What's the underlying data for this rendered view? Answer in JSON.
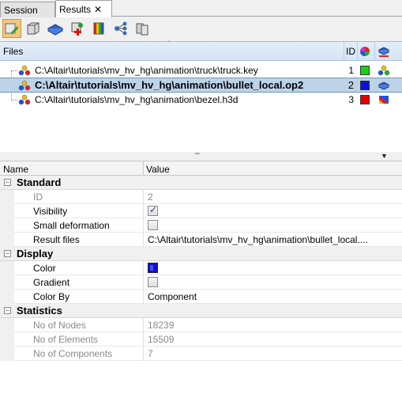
{
  "tabs": [
    {
      "label": "Session"
    },
    {
      "label": "Results",
      "close": "✕"
    }
  ],
  "toolbar": {
    "buttons": [
      "load-results-icon",
      "box-icon",
      "model-layer-icon",
      "add-component-icon",
      "contour-icon",
      "tree-network-icon",
      "cylinder-stack-icon"
    ]
  },
  "files": {
    "header": {
      "name": "Files",
      "id": "ID",
      "sort_indicator": "ˆ"
    },
    "rows": [
      {
        "path": "C:\\Altair\\tutorials\\mv_hv_hg\\animation\\truck\\truck.key",
        "id": "1",
        "color": "#16d216",
        "icon": "model-icon"
      },
      {
        "path": "C:\\Altair\\tutorials\\mv_hv_hg\\animation\\bullet_local.op2",
        "id": "2",
        "color": "#1010d0",
        "icon": "model-icon"
      },
      {
        "path": "C:\\Altair\\tutorials\\mv_hv_hg\\animation\\bezel.h3d",
        "id": "3",
        "color": "#e00000",
        "icon": "model-icon"
      }
    ]
  },
  "splitter": {
    "grip": "'''",
    "menu": "▼"
  },
  "props": {
    "header": {
      "name": "Name",
      "value": "Value"
    },
    "groups": {
      "standard": {
        "title": "Standard",
        "id_label": "ID",
        "id_value": "2",
        "visibility_label": "Visibility",
        "visibility_checked": true,
        "smalldef_label": "Small deformation",
        "smalldef_checked": false,
        "resultfiles_label": "Result files",
        "resultfiles_value": "C:\\Altair\\tutorials\\mv_hv_hg\\animation\\bullet_local...."
      },
      "display": {
        "title": "Display",
        "color_label": "Color",
        "color_value": "#1010d0",
        "gradient_label": "Gradient",
        "gradient_checked": false,
        "colorby_label": "Color By",
        "colorby_value": "Component"
      },
      "statistics": {
        "title": "Statistics",
        "nodes_label": "No of Nodes",
        "nodes_value": "18239",
        "elements_label": "No of Elements",
        "elements_value": "15509",
        "components_label": "No of Components",
        "components_value": "7"
      }
    }
  }
}
